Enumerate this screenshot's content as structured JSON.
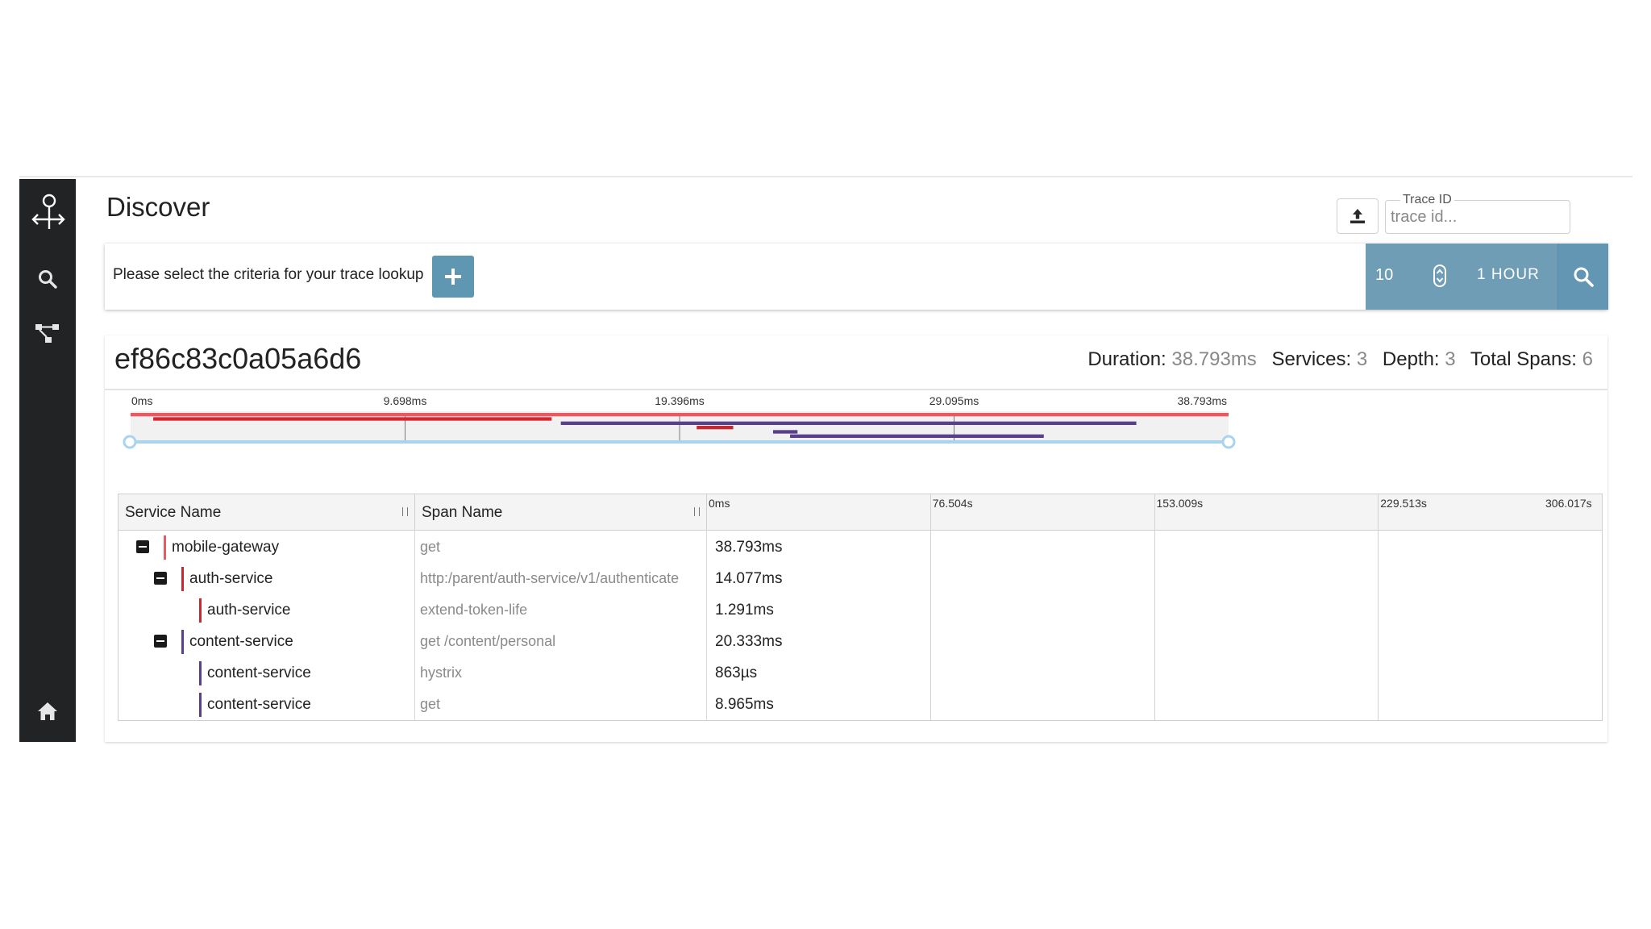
{
  "header": {
    "title": "Discover",
    "trace_id_label": "Trace ID",
    "trace_id_placeholder": "trace id..."
  },
  "criteria": {
    "prompt": "Please select the criteria for your trace lookup",
    "limit": "10",
    "lookback": "1 HOUR"
  },
  "trace": {
    "id": "ef86c83c0a05a6d6",
    "summary": {
      "duration_label": "Duration:",
      "duration": "38.793ms",
      "services_label": "Services:",
      "services": "3",
      "depth_label": "Depth:",
      "depth": "3",
      "spans_label": "Total Spans:",
      "spans": "6"
    },
    "minimap_ticks": [
      "0ms",
      "9.698ms",
      "19.396ms",
      "29.095ms",
      "38.793ms"
    ],
    "minimap_spans": [
      {
        "start": 0,
        "end": 38.793,
        "color": "#e85a62"
      },
      {
        "start": 0.8,
        "end": 14.877,
        "color": "#d8262e"
      },
      {
        "start": 15.2,
        "end": 35.533,
        "color": "#5a3f8c"
      },
      {
        "start": 20.0,
        "end": 21.291,
        "color": "#c12a2e"
      },
      {
        "start": 22.7,
        "end": 23.563,
        "color": "#5a3f8c"
      },
      {
        "start": 23.3,
        "end": 32.265,
        "color": "#5a3f8c"
      }
    ]
  },
  "table": {
    "columns": {
      "service": "Service Name",
      "span": "Span Name"
    },
    "timeline_ticks": [
      "0ms",
      "76.504s",
      "153.009s",
      "229.513s",
      "306.017s"
    ],
    "rows": [
      {
        "depth": 0,
        "collapsible": true,
        "service": "mobile-gateway",
        "span": "get",
        "duration": "38.793ms",
        "color": "#e85a62"
      },
      {
        "depth": 1,
        "collapsible": true,
        "service": "auth-service",
        "span": "http:/parent/auth-service/v1/authenticate",
        "duration": "14.077ms",
        "color": "#c8282e"
      },
      {
        "depth": 2,
        "collapsible": false,
        "service": "auth-service",
        "span": "extend-token-life",
        "duration": "1.291ms",
        "color": "#c8282e"
      },
      {
        "depth": 1,
        "collapsible": true,
        "service": "content-service",
        "span": "get /content/personal",
        "duration": "20.333ms",
        "color": "#5a3f8c"
      },
      {
        "depth": 2,
        "collapsible": false,
        "service": "content-service",
        "span": "hystrix",
        "duration": "863µs",
        "color": "#5a3f8c"
      },
      {
        "depth": 2,
        "collapsible": false,
        "service": "content-service",
        "span": "get",
        "duration": "8.965ms",
        "color": "#5a3f8c"
      }
    ]
  },
  "icons": {
    "logo": "zipkin-logo-icon",
    "search": "search-icon",
    "dependencies": "dependencies-icon",
    "home": "home-icon"
  },
  "colors": {
    "sidebar": "#222325",
    "accent": "#6f9db6",
    "root_span": "#e85a62",
    "auth_service": "#c8282e",
    "content_service": "#5a3f8c",
    "minimap_slider": "#a8d4ef"
  }
}
